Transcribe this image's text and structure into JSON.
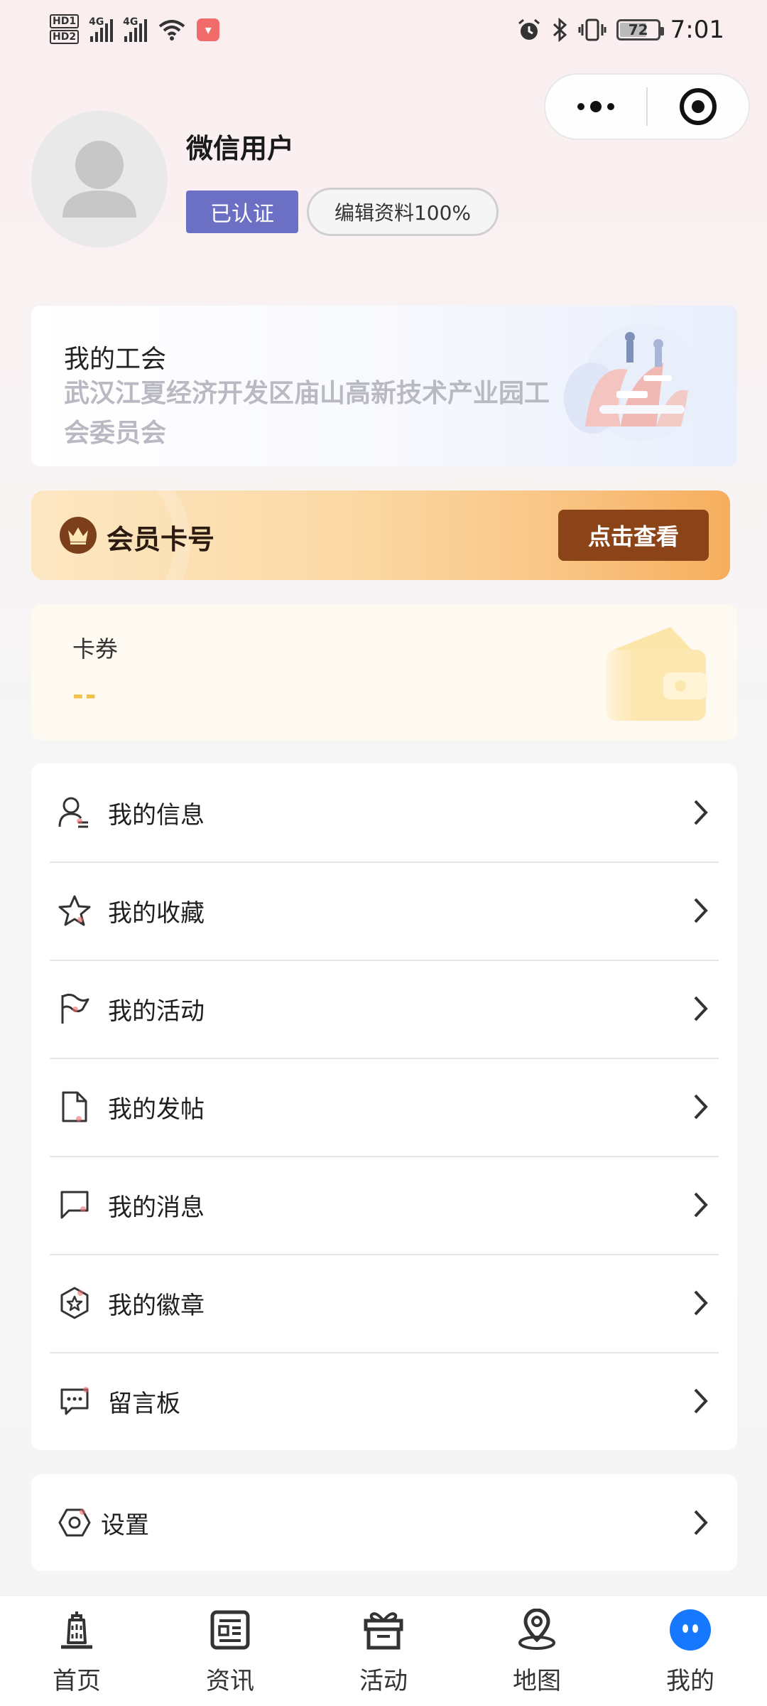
{
  "status_bar": {
    "hd1": "HD1",
    "hd2": "HD2",
    "net1": "4G",
    "net2": "4G",
    "battery": "72",
    "time": "7:01"
  },
  "profile": {
    "username": "微信用户",
    "verified_label": "已认证",
    "edit_label": "编辑资料100%"
  },
  "union": {
    "title": "我的工会",
    "name": "武汉江夏经济开发区庙山高新技术产业园工会委员会"
  },
  "member_card": {
    "label": "会员卡号",
    "button": "点击查看"
  },
  "coupon": {
    "title": "卡券",
    "value": "--"
  },
  "menu": {
    "items": [
      {
        "label": "我的信息",
        "icon": "user-info-icon"
      },
      {
        "label": "我的收藏",
        "icon": "star-icon"
      },
      {
        "label": "我的活动",
        "icon": "flag-icon"
      },
      {
        "label": "我的发帖",
        "icon": "document-icon"
      },
      {
        "label": "我的消息",
        "icon": "message-icon"
      },
      {
        "label": "我的徽章",
        "icon": "badge-icon"
      },
      {
        "label": "留言板",
        "icon": "comment-icon"
      }
    ],
    "settings": {
      "label": "设置",
      "icon": "settings-icon"
    }
  },
  "tabbar": {
    "items": [
      {
        "label": "首页",
        "icon": "home-tower-icon"
      },
      {
        "label": "资讯",
        "icon": "news-icon"
      },
      {
        "label": "活动",
        "icon": "gift-icon"
      },
      {
        "label": "地图",
        "icon": "map-pin-icon"
      },
      {
        "label": "我的",
        "icon": "profile-icon",
        "active": true
      }
    ]
  },
  "colors": {
    "accent_blue": "#1677ff",
    "verified_bg": "#6b70c4",
    "member_button": "#8b4418",
    "coupon_value": "#f0c14b"
  }
}
